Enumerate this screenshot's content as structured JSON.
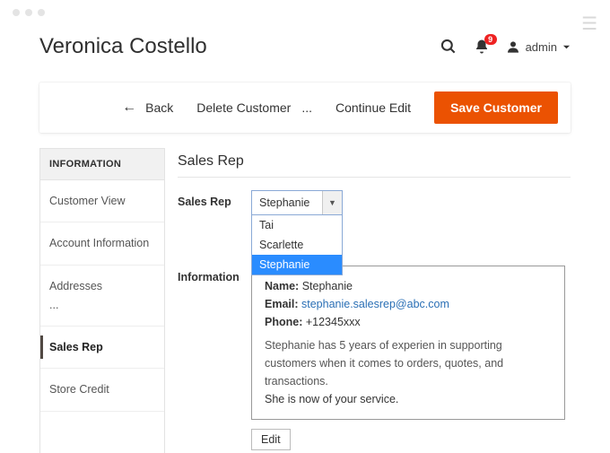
{
  "header": {
    "page_title": "Veronica Costello",
    "notif_count": "9",
    "admin_label": "admin"
  },
  "action_bar": {
    "back": "Back",
    "delete": "Delete Customer",
    "ellipsis": "...",
    "continue": "Continue Edit",
    "save": "Save Customer"
  },
  "sidebar": {
    "heading": "INFORMATION",
    "items": {
      "customer_view": "Customer View",
      "account_info": "Account Information",
      "addresses": "Addresses",
      "addresses_more": "...",
      "sales_rep": "Sales Rep",
      "store_credit": "Store Credit"
    }
  },
  "main": {
    "section_title": "Sales Rep",
    "field_label": "Sales Rep",
    "select_value": "Stephanie",
    "options": [
      "Tai",
      "Scarlette",
      "Stephanie"
    ],
    "info_label": "Information",
    "info": {
      "name_label": "Name:",
      "name_value": "Stephanie",
      "email_label": "Email:",
      "email_value": "stephanie.salesrep@abc.com",
      "phone_label": "Phone:",
      "phone_value": "+12345xxx",
      "bio_line1": "Stephanie has 5 years of experien in supporting customers when it comes to orders, quotes, and transactions.",
      "bio_line2": "She is now of your service."
    },
    "edit_label": "Edit"
  }
}
